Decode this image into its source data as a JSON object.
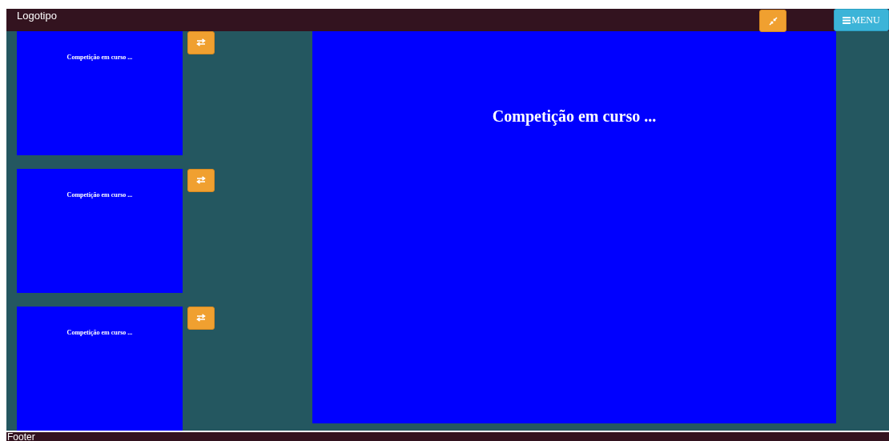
{
  "header": {
    "logo": "Logotipo",
    "menu_button": "MENU"
  },
  "thumbnails": [
    {
      "caption": "Competição em curso ..."
    },
    {
      "caption": "Competição em curso ..."
    },
    {
      "caption": "Competição em curso ..."
    }
  ],
  "main_panel": {
    "caption": "Competição em curso ..."
  },
  "footer": "Footer"
}
